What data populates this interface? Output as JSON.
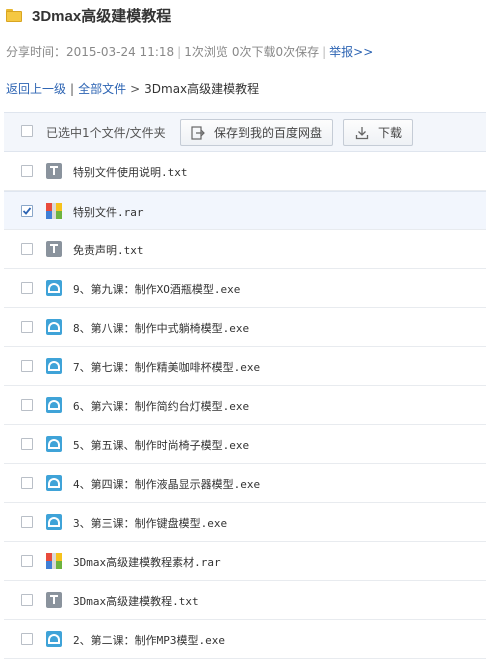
{
  "header": {
    "title": "3Dmax高级建模教程"
  },
  "meta": {
    "share_time": "分享时间：2015-03-24 11:18",
    "views": "1次浏览",
    "downloads": "0次下载",
    "saves": "0次保存",
    "report_link": "举报>>"
  },
  "breadcrumb": {
    "back": "返回上一级",
    "all_files": "全部文件",
    "separator": ">",
    "current": "3Dmax高级建模教程"
  },
  "toolbar": {
    "selection_text": "已选中1个文件/文件夹",
    "save_label": "保存到我的百度网盘",
    "download_label": "下载"
  },
  "files": [
    {
      "name": "特别文件使用说明.txt",
      "type": "txt",
      "checked": false
    },
    {
      "name": "特别文件.rar",
      "type": "rar",
      "checked": true
    },
    {
      "name": "免责声明.txt",
      "type": "txt",
      "checked": false
    },
    {
      "name": "9、第九课：制作XO酒瓶模型.exe",
      "type": "exe",
      "checked": false
    },
    {
      "name": "8、第八课：制作中式躺椅模型.exe",
      "type": "exe",
      "checked": false
    },
    {
      "name": "7、第七课：制作精美咖啡杯模型.exe",
      "type": "exe",
      "checked": false
    },
    {
      "name": "6、第六课：制作简约台灯模型.exe",
      "type": "exe",
      "checked": false
    },
    {
      "name": "5、第五课、制作时尚椅子模型.exe",
      "type": "exe",
      "checked": false
    },
    {
      "name": "4、第四课：制作液晶显示器模型.exe",
      "type": "exe",
      "checked": false
    },
    {
      "name": "3、第三课：制作键盘模型.exe",
      "type": "exe",
      "checked": false
    },
    {
      "name": "3Dmax高级建模教程素材.rar",
      "type": "rar",
      "checked": false
    },
    {
      "name": "3Dmax高级建模教程.txt",
      "type": "txt",
      "checked": false
    },
    {
      "name": "2、第二课：制作MP3模型.exe",
      "type": "exe",
      "checked": false
    }
  ],
  "colors": {
    "link": "#2d64b3",
    "toolbar_bg": "#f3f6fb",
    "check": "#2d64b3"
  }
}
